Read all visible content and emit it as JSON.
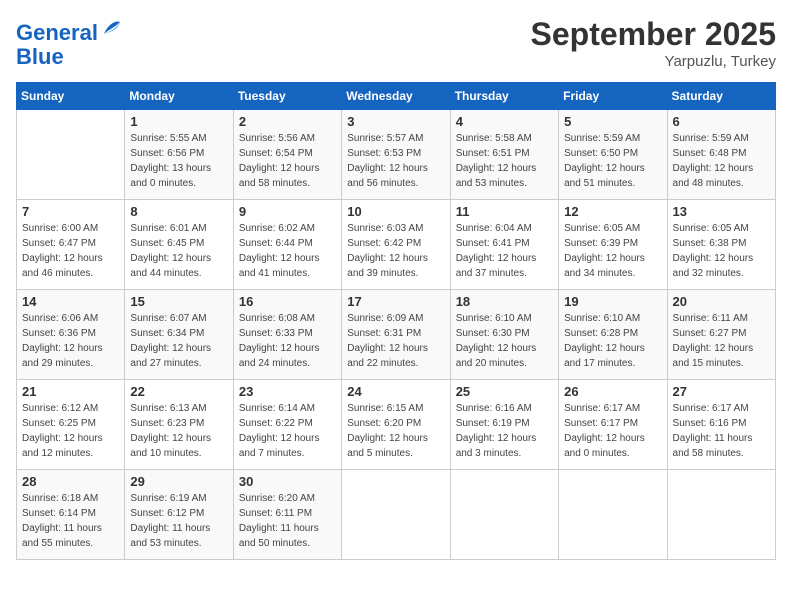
{
  "header": {
    "logo_line1": "General",
    "logo_line2": "Blue",
    "month": "September 2025",
    "location": "Yarpuzlu, Turkey"
  },
  "weekdays": [
    "Sunday",
    "Monday",
    "Tuesday",
    "Wednesday",
    "Thursday",
    "Friday",
    "Saturday"
  ],
  "weeks": [
    [
      {
        "day": "",
        "info": ""
      },
      {
        "day": "1",
        "info": "Sunrise: 5:55 AM\nSunset: 6:56 PM\nDaylight: 13 hours\nand 0 minutes."
      },
      {
        "day": "2",
        "info": "Sunrise: 5:56 AM\nSunset: 6:54 PM\nDaylight: 12 hours\nand 58 minutes."
      },
      {
        "day": "3",
        "info": "Sunrise: 5:57 AM\nSunset: 6:53 PM\nDaylight: 12 hours\nand 56 minutes."
      },
      {
        "day": "4",
        "info": "Sunrise: 5:58 AM\nSunset: 6:51 PM\nDaylight: 12 hours\nand 53 minutes."
      },
      {
        "day": "5",
        "info": "Sunrise: 5:59 AM\nSunset: 6:50 PM\nDaylight: 12 hours\nand 51 minutes."
      },
      {
        "day": "6",
        "info": "Sunrise: 5:59 AM\nSunset: 6:48 PM\nDaylight: 12 hours\nand 48 minutes."
      }
    ],
    [
      {
        "day": "7",
        "info": "Sunrise: 6:00 AM\nSunset: 6:47 PM\nDaylight: 12 hours\nand 46 minutes."
      },
      {
        "day": "8",
        "info": "Sunrise: 6:01 AM\nSunset: 6:45 PM\nDaylight: 12 hours\nand 44 minutes."
      },
      {
        "day": "9",
        "info": "Sunrise: 6:02 AM\nSunset: 6:44 PM\nDaylight: 12 hours\nand 41 minutes."
      },
      {
        "day": "10",
        "info": "Sunrise: 6:03 AM\nSunset: 6:42 PM\nDaylight: 12 hours\nand 39 minutes."
      },
      {
        "day": "11",
        "info": "Sunrise: 6:04 AM\nSunset: 6:41 PM\nDaylight: 12 hours\nand 37 minutes."
      },
      {
        "day": "12",
        "info": "Sunrise: 6:05 AM\nSunset: 6:39 PM\nDaylight: 12 hours\nand 34 minutes."
      },
      {
        "day": "13",
        "info": "Sunrise: 6:05 AM\nSunset: 6:38 PM\nDaylight: 12 hours\nand 32 minutes."
      }
    ],
    [
      {
        "day": "14",
        "info": "Sunrise: 6:06 AM\nSunset: 6:36 PM\nDaylight: 12 hours\nand 29 minutes."
      },
      {
        "day": "15",
        "info": "Sunrise: 6:07 AM\nSunset: 6:34 PM\nDaylight: 12 hours\nand 27 minutes."
      },
      {
        "day": "16",
        "info": "Sunrise: 6:08 AM\nSunset: 6:33 PM\nDaylight: 12 hours\nand 24 minutes."
      },
      {
        "day": "17",
        "info": "Sunrise: 6:09 AM\nSunset: 6:31 PM\nDaylight: 12 hours\nand 22 minutes."
      },
      {
        "day": "18",
        "info": "Sunrise: 6:10 AM\nSunset: 6:30 PM\nDaylight: 12 hours\nand 20 minutes."
      },
      {
        "day": "19",
        "info": "Sunrise: 6:10 AM\nSunset: 6:28 PM\nDaylight: 12 hours\nand 17 minutes."
      },
      {
        "day": "20",
        "info": "Sunrise: 6:11 AM\nSunset: 6:27 PM\nDaylight: 12 hours\nand 15 minutes."
      }
    ],
    [
      {
        "day": "21",
        "info": "Sunrise: 6:12 AM\nSunset: 6:25 PM\nDaylight: 12 hours\nand 12 minutes."
      },
      {
        "day": "22",
        "info": "Sunrise: 6:13 AM\nSunset: 6:23 PM\nDaylight: 12 hours\nand 10 minutes."
      },
      {
        "day": "23",
        "info": "Sunrise: 6:14 AM\nSunset: 6:22 PM\nDaylight: 12 hours\nand 7 minutes."
      },
      {
        "day": "24",
        "info": "Sunrise: 6:15 AM\nSunset: 6:20 PM\nDaylight: 12 hours\nand 5 minutes."
      },
      {
        "day": "25",
        "info": "Sunrise: 6:16 AM\nSunset: 6:19 PM\nDaylight: 12 hours\nand 3 minutes."
      },
      {
        "day": "26",
        "info": "Sunrise: 6:17 AM\nSunset: 6:17 PM\nDaylight: 12 hours\nand 0 minutes."
      },
      {
        "day": "27",
        "info": "Sunrise: 6:17 AM\nSunset: 6:16 PM\nDaylight: 11 hours\nand 58 minutes."
      }
    ],
    [
      {
        "day": "28",
        "info": "Sunrise: 6:18 AM\nSunset: 6:14 PM\nDaylight: 11 hours\nand 55 minutes."
      },
      {
        "day": "29",
        "info": "Sunrise: 6:19 AM\nSunset: 6:12 PM\nDaylight: 11 hours\nand 53 minutes."
      },
      {
        "day": "30",
        "info": "Sunrise: 6:20 AM\nSunset: 6:11 PM\nDaylight: 11 hours\nand 50 minutes."
      },
      {
        "day": "",
        "info": ""
      },
      {
        "day": "",
        "info": ""
      },
      {
        "day": "",
        "info": ""
      },
      {
        "day": "",
        "info": ""
      }
    ]
  ]
}
